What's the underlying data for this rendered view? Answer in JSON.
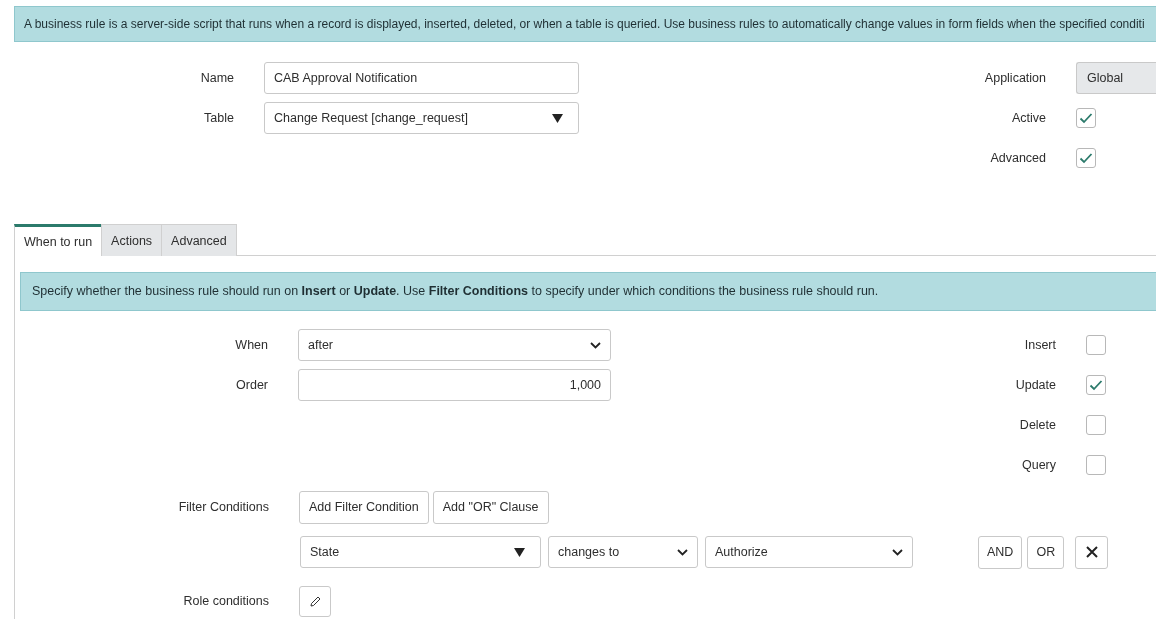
{
  "info_banner": "A business rule is a server-side script that runs when a record is displayed, inserted, deleted, or when a table is queried. Use business rules to automatically change values in form fields when the specified conditi",
  "form": {
    "left": [
      {
        "label": "Name",
        "kind": "text",
        "value": "CAB Approval Notification"
      },
      {
        "label": "Table",
        "kind": "reference",
        "value": "Change Request [change_request]"
      }
    ],
    "right": [
      {
        "label": "Application",
        "kind": "readonly",
        "value": "Global"
      },
      {
        "label": "Active",
        "kind": "checkbox",
        "checked": true
      },
      {
        "label": "Advanced",
        "kind": "checkbox",
        "checked": true
      }
    ]
  },
  "tabs": [
    {
      "label": "When to run",
      "selected": true
    },
    {
      "label": "Actions",
      "selected": false
    },
    {
      "label": "Advanced",
      "selected": false
    }
  ],
  "tab_banner": "Specify whether the business rule should run on **Insert** or **Update**. Use **Filter Conditions** to specify under which conditions the business rule should run.",
  "when_fields": [
    {
      "label": "When",
      "kind": "select",
      "value": "after"
    },
    {
      "label": "Order",
      "kind": "number",
      "value": "1,000"
    }
  ],
  "operations": [
    {
      "label": "Insert",
      "checked": false
    },
    {
      "label": "Update",
      "checked": true
    },
    {
      "label": "Delete",
      "checked": false
    },
    {
      "label": "Query",
      "checked": false
    }
  ],
  "filter": {
    "label": "Filter Conditions",
    "buttons": [
      "Add Filter Condition",
      "Add \"OR\" Clause"
    ],
    "condition": {
      "field": "State",
      "operator": "changes to",
      "value": "Authorize"
    },
    "joins": [
      "AND",
      "OR"
    ]
  },
  "role_conditions": {
    "label": "Role conditions"
  }
}
